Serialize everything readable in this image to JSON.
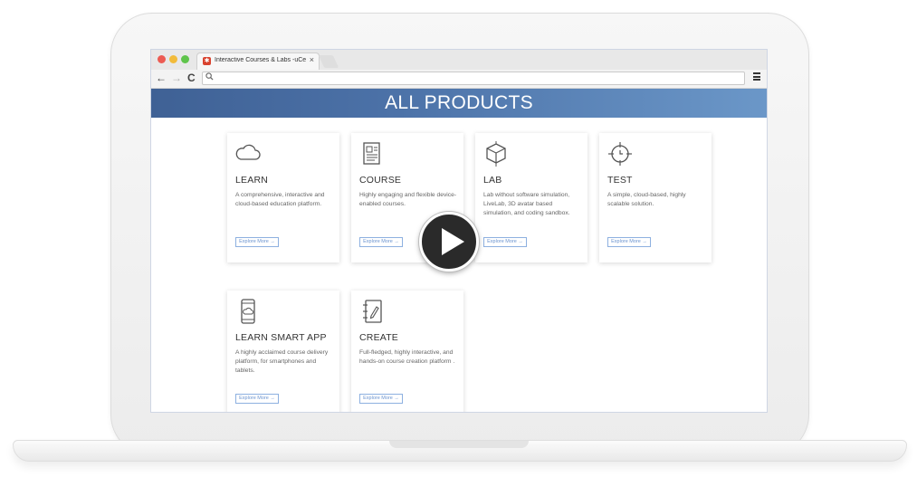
{
  "browser": {
    "tab_title": "Interactive Courses & Labs -uCe",
    "tab_close": "×",
    "nav_back": "←",
    "nav_forward": "→",
    "nav_reload": "C",
    "omnibox_icon": "🔍",
    "url": ""
  },
  "page": {
    "banner_title": "ALL PRODUCTS",
    "cards": [
      {
        "title": "LEARN",
        "description": "A comprehensive, interactive and cloud-based education platform.",
        "button": "Explore More →",
        "icon": "cloud-icon"
      },
      {
        "title": "COURSE",
        "description": "Highly engaging and flexible device-enabled courses.",
        "button": "Explore More →",
        "icon": "document-icon"
      },
      {
        "title": "LAB",
        "description": "Lab without software simulation, LiveLab, 3D avatar based simulation, and coding sandbox.",
        "button": "Explore More →",
        "icon": "cube-icon"
      },
      {
        "title": "TEST",
        "description": "A simple, cloud-based, highly scalable solution.",
        "button": "Explore More →",
        "icon": "crosshair-icon"
      },
      {
        "title": "LEARN SMART APP",
        "description": "A highly acclaimed course delivery platform, for smartphones and tablets.",
        "button": "Explore More →",
        "icon": "mobile-cloud-icon"
      },
      {
        "title": "CREATE",
        "description": "Full-fledged, highly interactive, and hands-on course creation platform .",
        "button": "Explore More →",
        "icon": "notebook-pen-icon"
      }
    ]
  },
  "video": {
    "icon": "play-icon"
  },
  "colors": {
    "banner_start": "#3f6195",
    "banner_end": "#6b97c8",
    "accent": "#6a93cf"
  }
}
